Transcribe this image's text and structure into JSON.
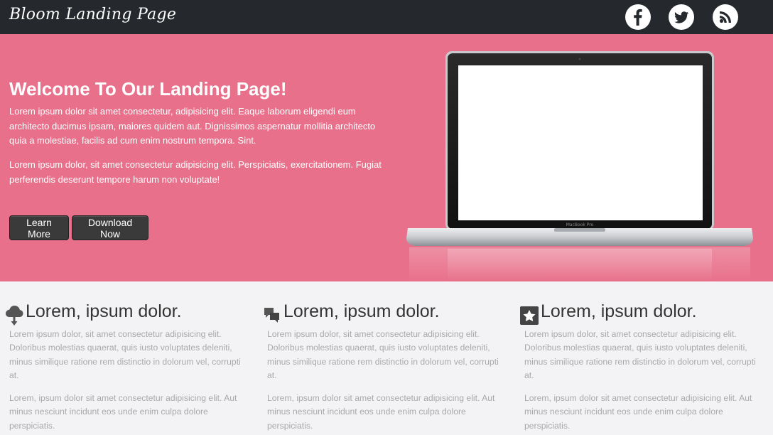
{
  "header": {
    "brand": "Bloom Landing Page",
    "social": [
      "facebook-icon",
      "twitter-icon",
      "rss-icon"
    ]
  },
  "hero": {
    "title": "Welcome To Our Landing Page!",
    "paragraph1": "Lorem ipsum dolor sit amet consectetur, adipisicing elit. Eaque laborum eligendi eum architecto ducimus ipsam, maiores quidem aut. Dignissimos aspernatur mollitia architecto quia a molestiae, facilis ad cum enim nostrum tempora. Sint.",
    "paragraph2": "Lorem ipsum dolor, sit amet consectetur adipisicing elit. Perspiciatis, exercitationem. Fugiat perferendis deserunt tempore harum non voluptate!",
    "buttons": {
      "learn_more": "Learn More",
      "download_now": "Download Now"
    },
    "laptop_label": "MacBook Pro"
  },
  "features": [
    {
      "icon": "cloud-download-icon",
      "title": "Lorem, ipsum dolor.",
      "paragraph1": "Lorem ipsum dolor, sit amet consectetur adipisicing elit. Doloribus molestias quaerat, quis iusto voluptates deleniti, minus similique ratione rem distinctio in dolorum vel, corrupti at.",
      "paragraph2": "Lorem, ipsum dolor sit amet consectetur adipisicing elit. Aut minus nesciunt incidunt eos unde enim culpa dolore perspiciatis."
    },
    {
      "icon": "chat-bubbles-icon",
      "title": "Lorem, ipsum dolor.",
      "paragraph1": "Lorem ipsum dolor, sit amet consectetur adipisicing elit. Doloribus molestias quaerat, quis iusto voluptates deleniti, minus similique ratione rem distinctio in dolorum vel, corrupti at.",
      "paragraph2": "Lorem, ipsum dolor sit amet consectetur adipisicing elit. Aut minus nesciunt incidunt eos unde enim culpa dolore perspiciatis."
    },
    {
      "icon": "star-badge-icon",
      "title": "Lorem, ipsum dolor.",
      "paragraph1": "Lorem ipsum dolor, sit amet consectetur adipisicing elit. Doloribus molestias quaerat, quis iusto voluptates deleniti, minus similique ratione rem distinctio in dolorum vel, corrupti at.",
      "paragraph2": "Lorem, ipsum dolor sit amet consectetur adipisicing elit. Aut minus nesciunt incidunt eos unde enim culpa dolore perspiciatis."
    }
  ],
  "colors": {
    "header_bg": "#25282c",
    "hero_bg": "#e8708a",
    "features_bg": "#f3f3f5",
    "button_bg": "#3a3a3a"
  }
}
